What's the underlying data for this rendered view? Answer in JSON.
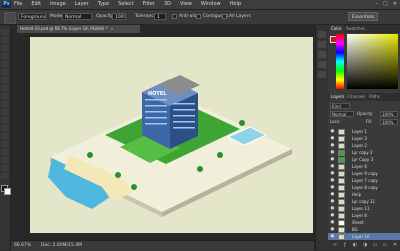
{
  "menubar": {
    "logo": "Ps",
    "items": [
      "File",
      "Edit",
      "Image",
      "Layer",
      "Type",
      "Select",
      "Filter",
      "3D",
      "View",
      "Window",
      "Help"
    ],
    "window_controls": [
      "–",
      "□",
      "✕"
    ]
  },
  "options": {
    "preset": "Foreground",
    "mode_label": "Mode:",
    "mode_value": "Normal",
    "opacity_label": "Opacity:",
    "opacity_value": "100%",
    "tolerance_label": "Tolerance:",
    "tolerance_value": "1",
    "antialias_label": "Anti-alias",
    "contiguous_label": "Contiguous",
    "all_layers_label": "All Layers",
    "workspace": "Essentials"
  },
  "document": {
    "tab_title": "Hotel4-10.psd @ 66.7% (Layer 18, RGB/8) *",
    "tab_close": "×"
  },
  "status": {
    "zoom": "66.67%",
    "doc": "Doc: 2.00M/15.4M"
  },
  "panels": {
    "color_tabs": [
      "Color",
      "Swatches"
    ],
    "layers_tabs": [
      "Layers",
      "Channels",
      "Paths"
    ],
    "kind_label": "Kind",
    "blend_mode": "Normal",
    "opacity_label": "Opacity:",
    "opacity_value": "100%",
    "lock_label": "Lock:",
    "fill_label": "Fill:",
    "fill_value": "100%",
    "colors": {
      "foreground": "#d4181a",
      "active_layer": "#5879a5"
    },
    "layers": [
      {
        "name": "Layer 1",
        "active": false
      },
      {
        "name": "Layer 3",
        "active": false
      },
      {
        "name": "Layer 2",
        "active": false
      },
      {
        "name": "Lyr copy 2",
        "active": false
      },
      {
        "name": "Lyr Copy 3",
        "active": false
      },
      {
        "name": "Layer 6",
        "active": false
      },
      {
        "name": "Layer 9 copy",
        "active": false
      },
      {
        "name": "Layer 7 copy",
        "active": false
      },
      {
        "name": "Layer 8 copy",
        "active": false
      },
      {
        "name": "Help",
        "active": false
      },
      {
        "name": "Lyr copy 11",
        "active": false
      },
      {
        "name": "Layer 11",
        "active": false
      },
      {
        "name": "Layer 8",
        "active": false
      },
      {
        "name": "Sheet",
        "active": false
      },
      {
        "name": "BG",
        "active": false
      },
      {
        "name": "Layer 16",
        "active": true
      }
    ]
  },
  "canvas": {
    "sign_text": "HOTEL",
    "colors": {
      "background": "#e3e6c8",
      "base": "#f1efd9",
      "lawn": "#3ea535",
      "pool": "#8fd3e8",
      "beach": "#f4e7b8",
      "water": "#4fb7de",
      "building": "#3f67a8"
    }
  }
}
